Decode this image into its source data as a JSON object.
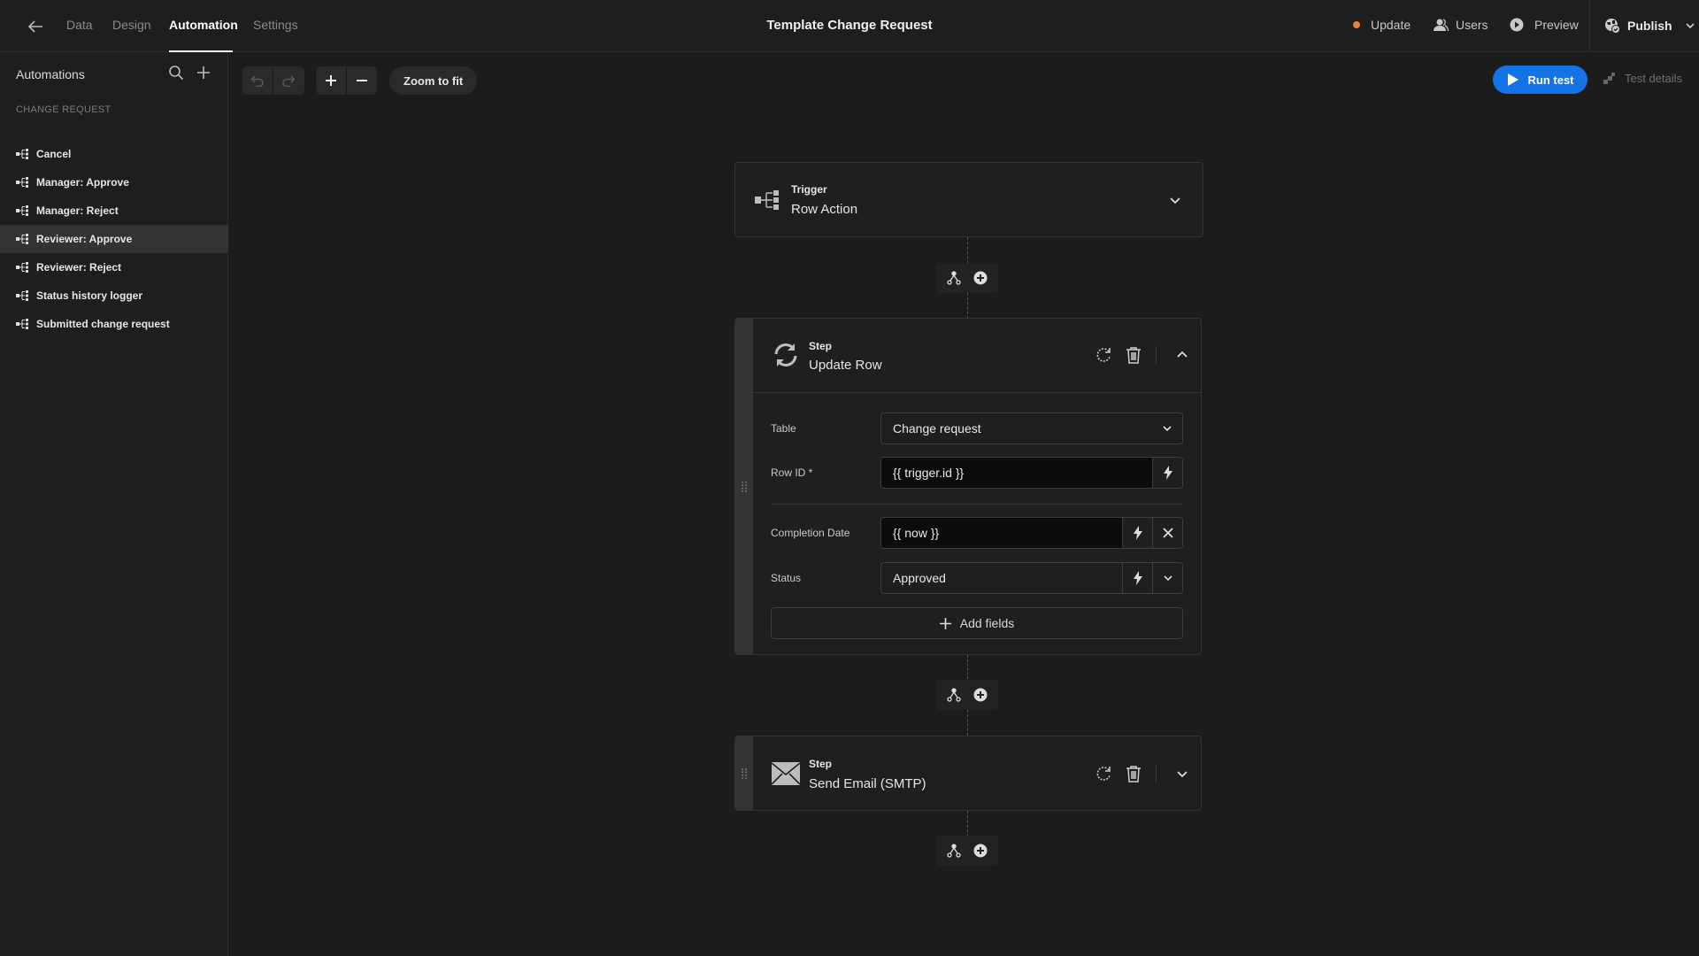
{
  "topbar": {
    "tabs": [
      {
        "label": "Data",
        "active": false
      },
      {
        "label": "Design",
        "active": false
      },
      {
        "label": "Automation",
        "active": true
      },
      {
        "label": "Settings",
        "active": false
      }
    ],
    "title": "Template Change Request",
    "update_label": "Update",
    "update_dot_color": "#e8823a",
    "users_label": "Users",
    "preview_label": "Preview",
    "publish_label": "Publish"
  },
  "sidebar": {
    "title": "Automations",
    "section": "CHANGE REQUEST",
    "items": [
      {
        "label": "Cancel",
        "selected": false
      },
      {
        "label": "Manager: Approve",
        "selected": false
      },
      {
        "label": "Manager: Reject",
        "selected": false
      },
      {
        "label": "Reviewer: Approve",
        "selected": true
      },
      {
        "label": "Reviewer: Reject",
        "selected": false
      },
      {
        "label": "Status history logger",
        "selected": false
      },
      {
        "label": "Submitted change request",
        "selected": false
      }
    ]
  },
  "toolbar": {
    "zoom_to_fit_label": "Zoom to fit",
    "run_test_label": "Run test",
    "run_test_color": "#1473e6",
    "test_details_label": "Test details"
  },
  "flow": {
    "trigger": {
      "kind": "Trigger",
      "name": "Row Action"
    },
    "step1": {
      "kind": "Step",
      "name": "Update Row",
      "fields": {
        "table_label": "Table",
        "table_value": "Change request",
        "row_id_label": "Row ID *",
        "row_id_value": "{{ trigger.id }}",
        "completion_label": "Completion Date",
        "completion_value": "{{ now }}",
        "status_label": "Status",
        "status_value": "Approved"
      },
      "add_fields_label": "Add fields"
    },
    "step2": {
      "kind": "Step",
      "name": "Send Email (SMTP)"
    }
  }
}
